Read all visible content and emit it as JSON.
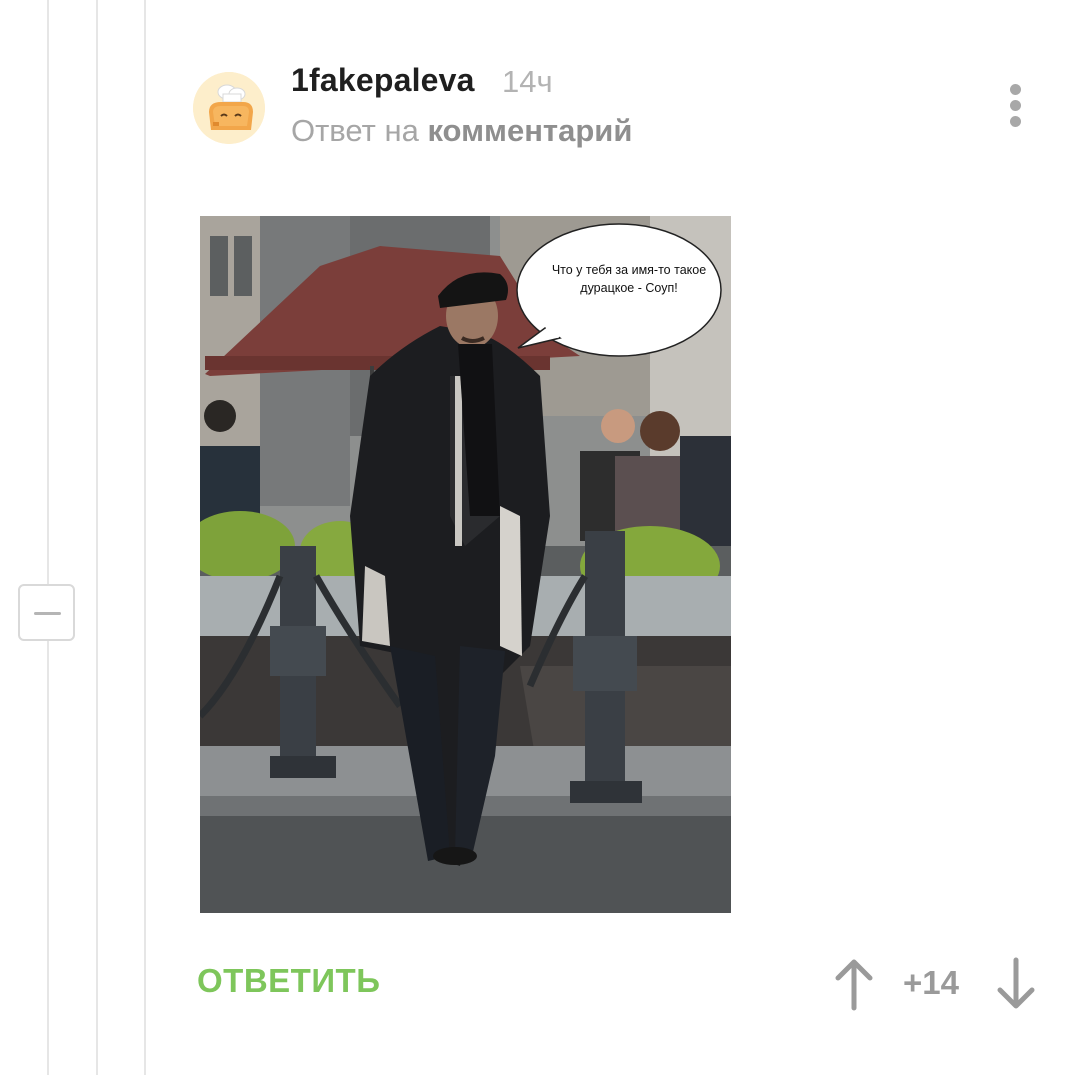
{
  "comment": {
    "author": "1fakepaleva",
    "time": "14ч",
    "reply_prefix": "Ответ на",
    "reply_target": "комментарий",
    "avatar_icon": "toast-chef-avatar",
    "more_icon": "more-vertical-icon"
  },
  "image": {
    "speech_bubble": "Что у тебя за имя-то такое дурацкое - Соуп!"
  },
  "actions": {
    "reply_label": "ОТВЕТИТЬ",
    "score": "+14",
    "upvote_icon": "arrow-up-icon",
    "downvote_icon": "arrow-down-icon",
    "collapse_icon": "collapse-minus-icon"
  },
  "colors": {
    "accent_green": "#7ec65b",
    "muted_text": "#a6a6a6",
    "thread_line": "#e6e6e6"
  }
}
